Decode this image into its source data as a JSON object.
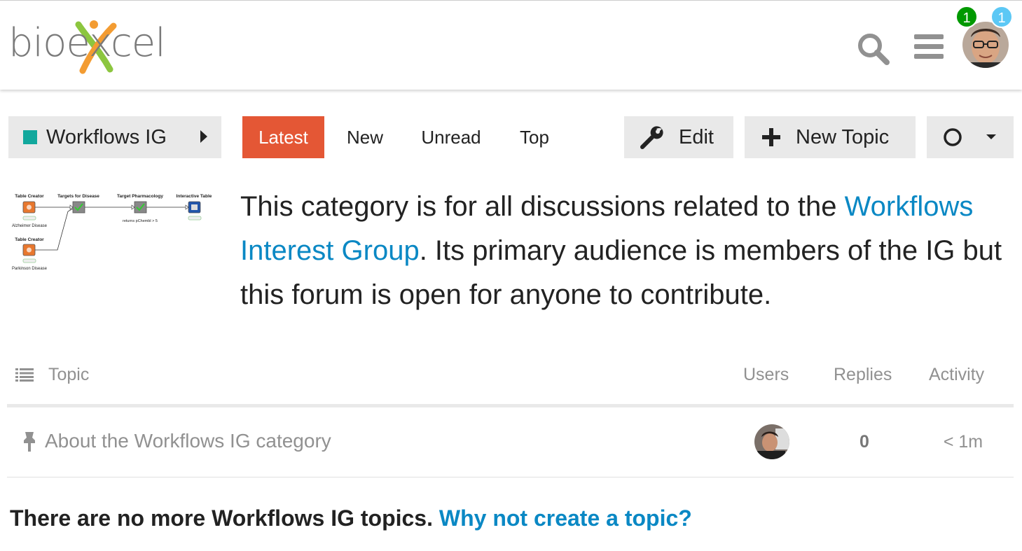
{
  "header": {
    "logo_text": "bioexcel",
    "notifications": {
      "unread_count": "1",
      "private_count": "1"
    }
  },
  "nav": {
    "category": "Workflows IG",
    "tabs": [
      "Latest",
      "New",
      "Unread",
      "Top"
    ],
    "active_tab": "Latest",
    "edit_label": "Edit",
    "new_topic_label": "New Topic"
  },
  "category_image": {
    "nodes": [
      "Table Creator",
      "Targets for Disease",
      "Target Pharmacology",
      "Interactive Table",
      "Table Creator"
    ],
    "captions": [
      "Alzheimer Disease",
      "Parkinson Disease",
      "returns pChembl > 5"
    ]
  },
  "description": {
    "before_link": "This category is for all discussions related to the ",
    "link": "Workflows Interest Group",
    "after_link": ". Its primary audience is members of the IG but this forum is open for anyone to contribute."
  },
  "table": {
    "headers": {
      "topic": "Topic",
      "users": "Users",
      "replies": "Replies",
      "activity": "Activity"
    },
    "rows": [
      {
        "title": "About the Workflows IG category",
        "replies": "0",
        "activity": "< 1m"
      }
    ]
  },
  "footer": {
    "message": "There are no more Workflows IG topics. ",
    "link": "Why not create a topic?"
  },
  "colors": {
    "accent": "#e45735",
    "category": "#12a89d",
    "link": "#0a88c4"
  }
}
